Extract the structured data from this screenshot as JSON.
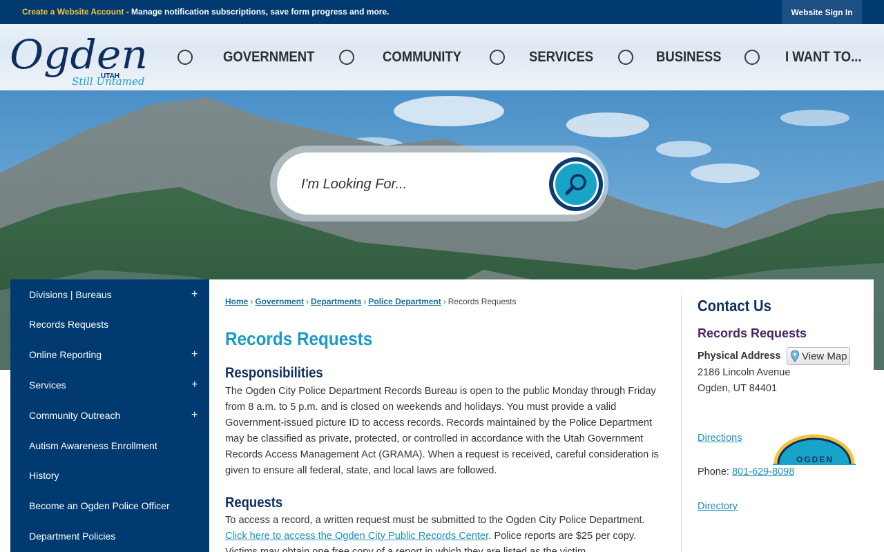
{
  "topbar": {
    "create_account": "Create a Website Account",
    "message": " - Manage notification subscriptions, save form progress and more.",
    "sign_in": "Website Sign In"
  },
  "logo": {
    "name": "Ogden",
    "state": "UTAH",
    "tagline": "Still Untamed"
  },
  "nav": {
    "items": [
      {
        "label": "GOVERNMENT"
      },
      {
        "label": "COMMUNITY"
      },
      {
        "label": "SERVICES"
      },
      {
        "label": "BUSINESS"
      },
      {
        "label": "I WANT TO..."
      }
    ]
  },
  "search": {
    "placeholder": "I'm Looking For..."
  },
  "sidebar": {
    "items": [
      {
        "label": "Divisions | Bureaus",
        "expandable": "+"
      },
      {
        "label": "Records Requests",
        "expandable": ""
      },
      {
        "label": "Online Reporting",
        "expandable": "+"
      },
      {
        "label": "Services",
        "expandable": "+"
      },
      {
        "label": "Community Outreach",
        "expandable": "+"
      },
      {
        "label": "Autism Awareness Enrollment",
        "expandable": ""
      },
      {
        "label": "History",
        "expandable": ""
      },
      {
        "label": "Become an Ogden Police Officer",
        "expandable": ""
      },
      {
        "label": "Department Policies",
        "expandable": ""
      }
    ]
  },
  "breadcrumb": {
    "items": [
      "Home",
      "Government",
      "Departments",
      "Police Department"
    ],
    "current": "Records Requests",
    "separator": "›"
  },
  "main": {
    "title": "Records Requests",
    "responsibilities_heading": "Responsibilities",
    "responsibilities_text": "The Ogden City Police Department Records Bureau is open to the public Monday through Friday from 8 a.m. to 5 p.m. and is closed on weekends and holidays. You must provide a valid Government-issued picture ID to access records. Records maintained by the Police Department may be classified as private, protected, or controlled in accordance with the Utah Government Records Access Management Act (GRAMA). When a request is received, careful consideration is given to ensure all federal, state, and local laws are followed.",
    "requests_heading": "Requests",
    "requests_text_1": "To access a record, a written request must be submitted to the Ogden City Police Department.",
    "requests_link": "Click here to access the Ogden City Public Records Center",
    "requests_text_2": ". Police reports are $25 per copy.",
    "requests_text_3": "Victims may obtain one free copy of a report in which they are listed as the victim."
  },
  "contact": {
    "title": "Contact Us",
    "subtitle": "Records Requests",
    "address_label": "Physical Address",
    "view_map": "View Map",
    "street": "2186 Lincoln Avenue",
    "city": "Ogden, UT 84401",
    "directions": "Directions",
    "phone_label": "Phone: ",
    "phone": "801-629-8098",
    "directory": "Directory",
    "badge_text": "OGDEN"
  },
  "colors": {
    "navy": "#003a70",
    "accent_blue": "#1a9ac8",
    "heading_navy": "#0d2f5e",
    "purple": "#4a2463",
    "gold": "#f5c33b"
  }
}
